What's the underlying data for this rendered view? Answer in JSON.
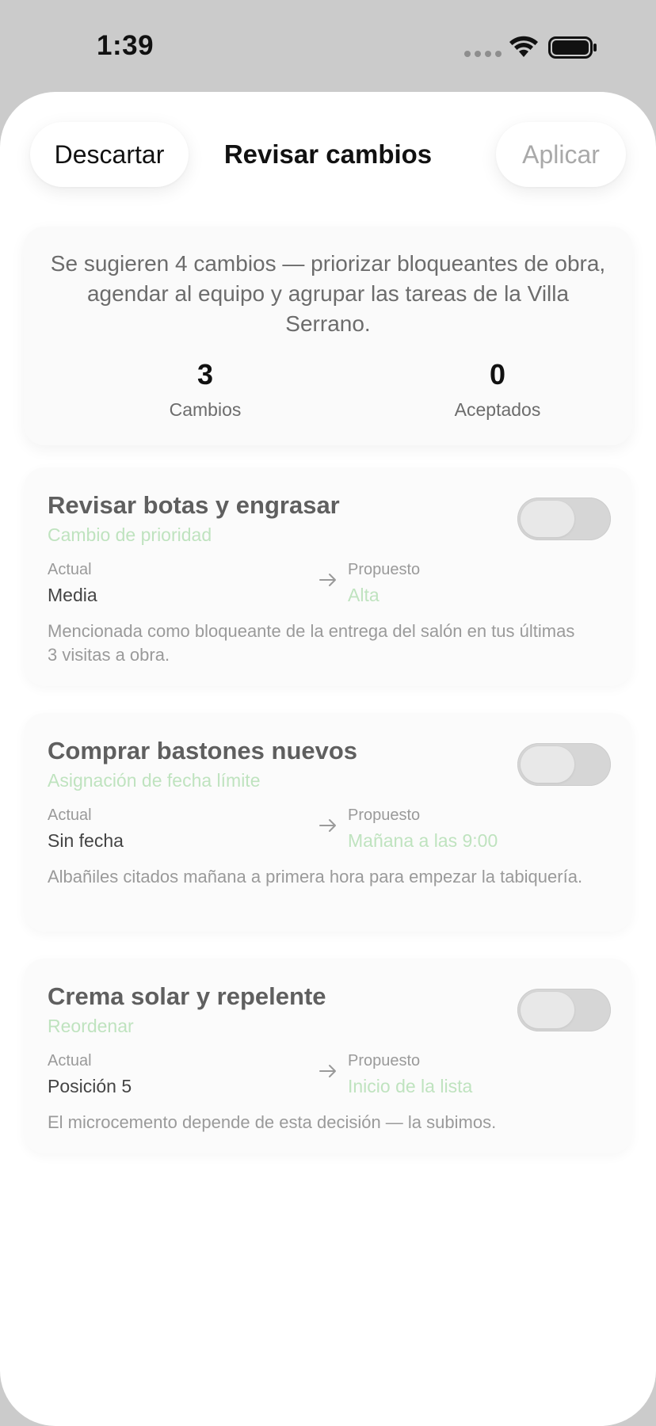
{
  "status_bar": {
    "time": "1:39"
  },
  "header": {
    "discard_label": "Descartar",
    "title": "Revisar cambios",
    "apply_label": "Aplicar"
  },
  "summary": {
    "text": "Se sugieren 4 cambios — priorizar bloqueantes de obra, agendar al equipo y agrupar las tareas de la Villa Serrano.",
    "changes_count": "3",
    "changes_label": "Cambios",
    "accepted_count": "0",
    "accepted_label": "Aceptados"
  },
  "labels": {
    "current": "Actual",
    "proposed": "Propuesto"
  },
  "changes": [
    {
      "title": "Revisar botas y engrasar",
      "type": "Cambio de prioridad",
      "current": "Media",
      "proposed": "Alta",
      "reason": "Mencionada como bloqueante de la entrega del salón en tus últimas 3 visitas a obra.",
      "accepted": false
    },
    {
      "title": "Comprar bastones nuevos",
      "type": "Asignación de fecha límite",
      "current": "Sin fecha",
      "proposed": "Mañana a las 9:00",
      "reason": "Albañiles citados mañana a primera hora para empezar la tabiquería.",
      "accepted": false
    },
    {
      "title": "Crema solar y repelente",
      "type": "Reordenar",
      "current": "Posición 5",
      "proposed": "Inicio de la lista",
      "reason": "El microcemento depende de esta decisión — la subimos.",
      "accepted": false
    }
  ],
  "colors": {
    "accent_green": "#bfe3bf",
    "apply_disabled": "#a9a9a9",
    "toggle_off": "#d6d6d6"
  }
}
